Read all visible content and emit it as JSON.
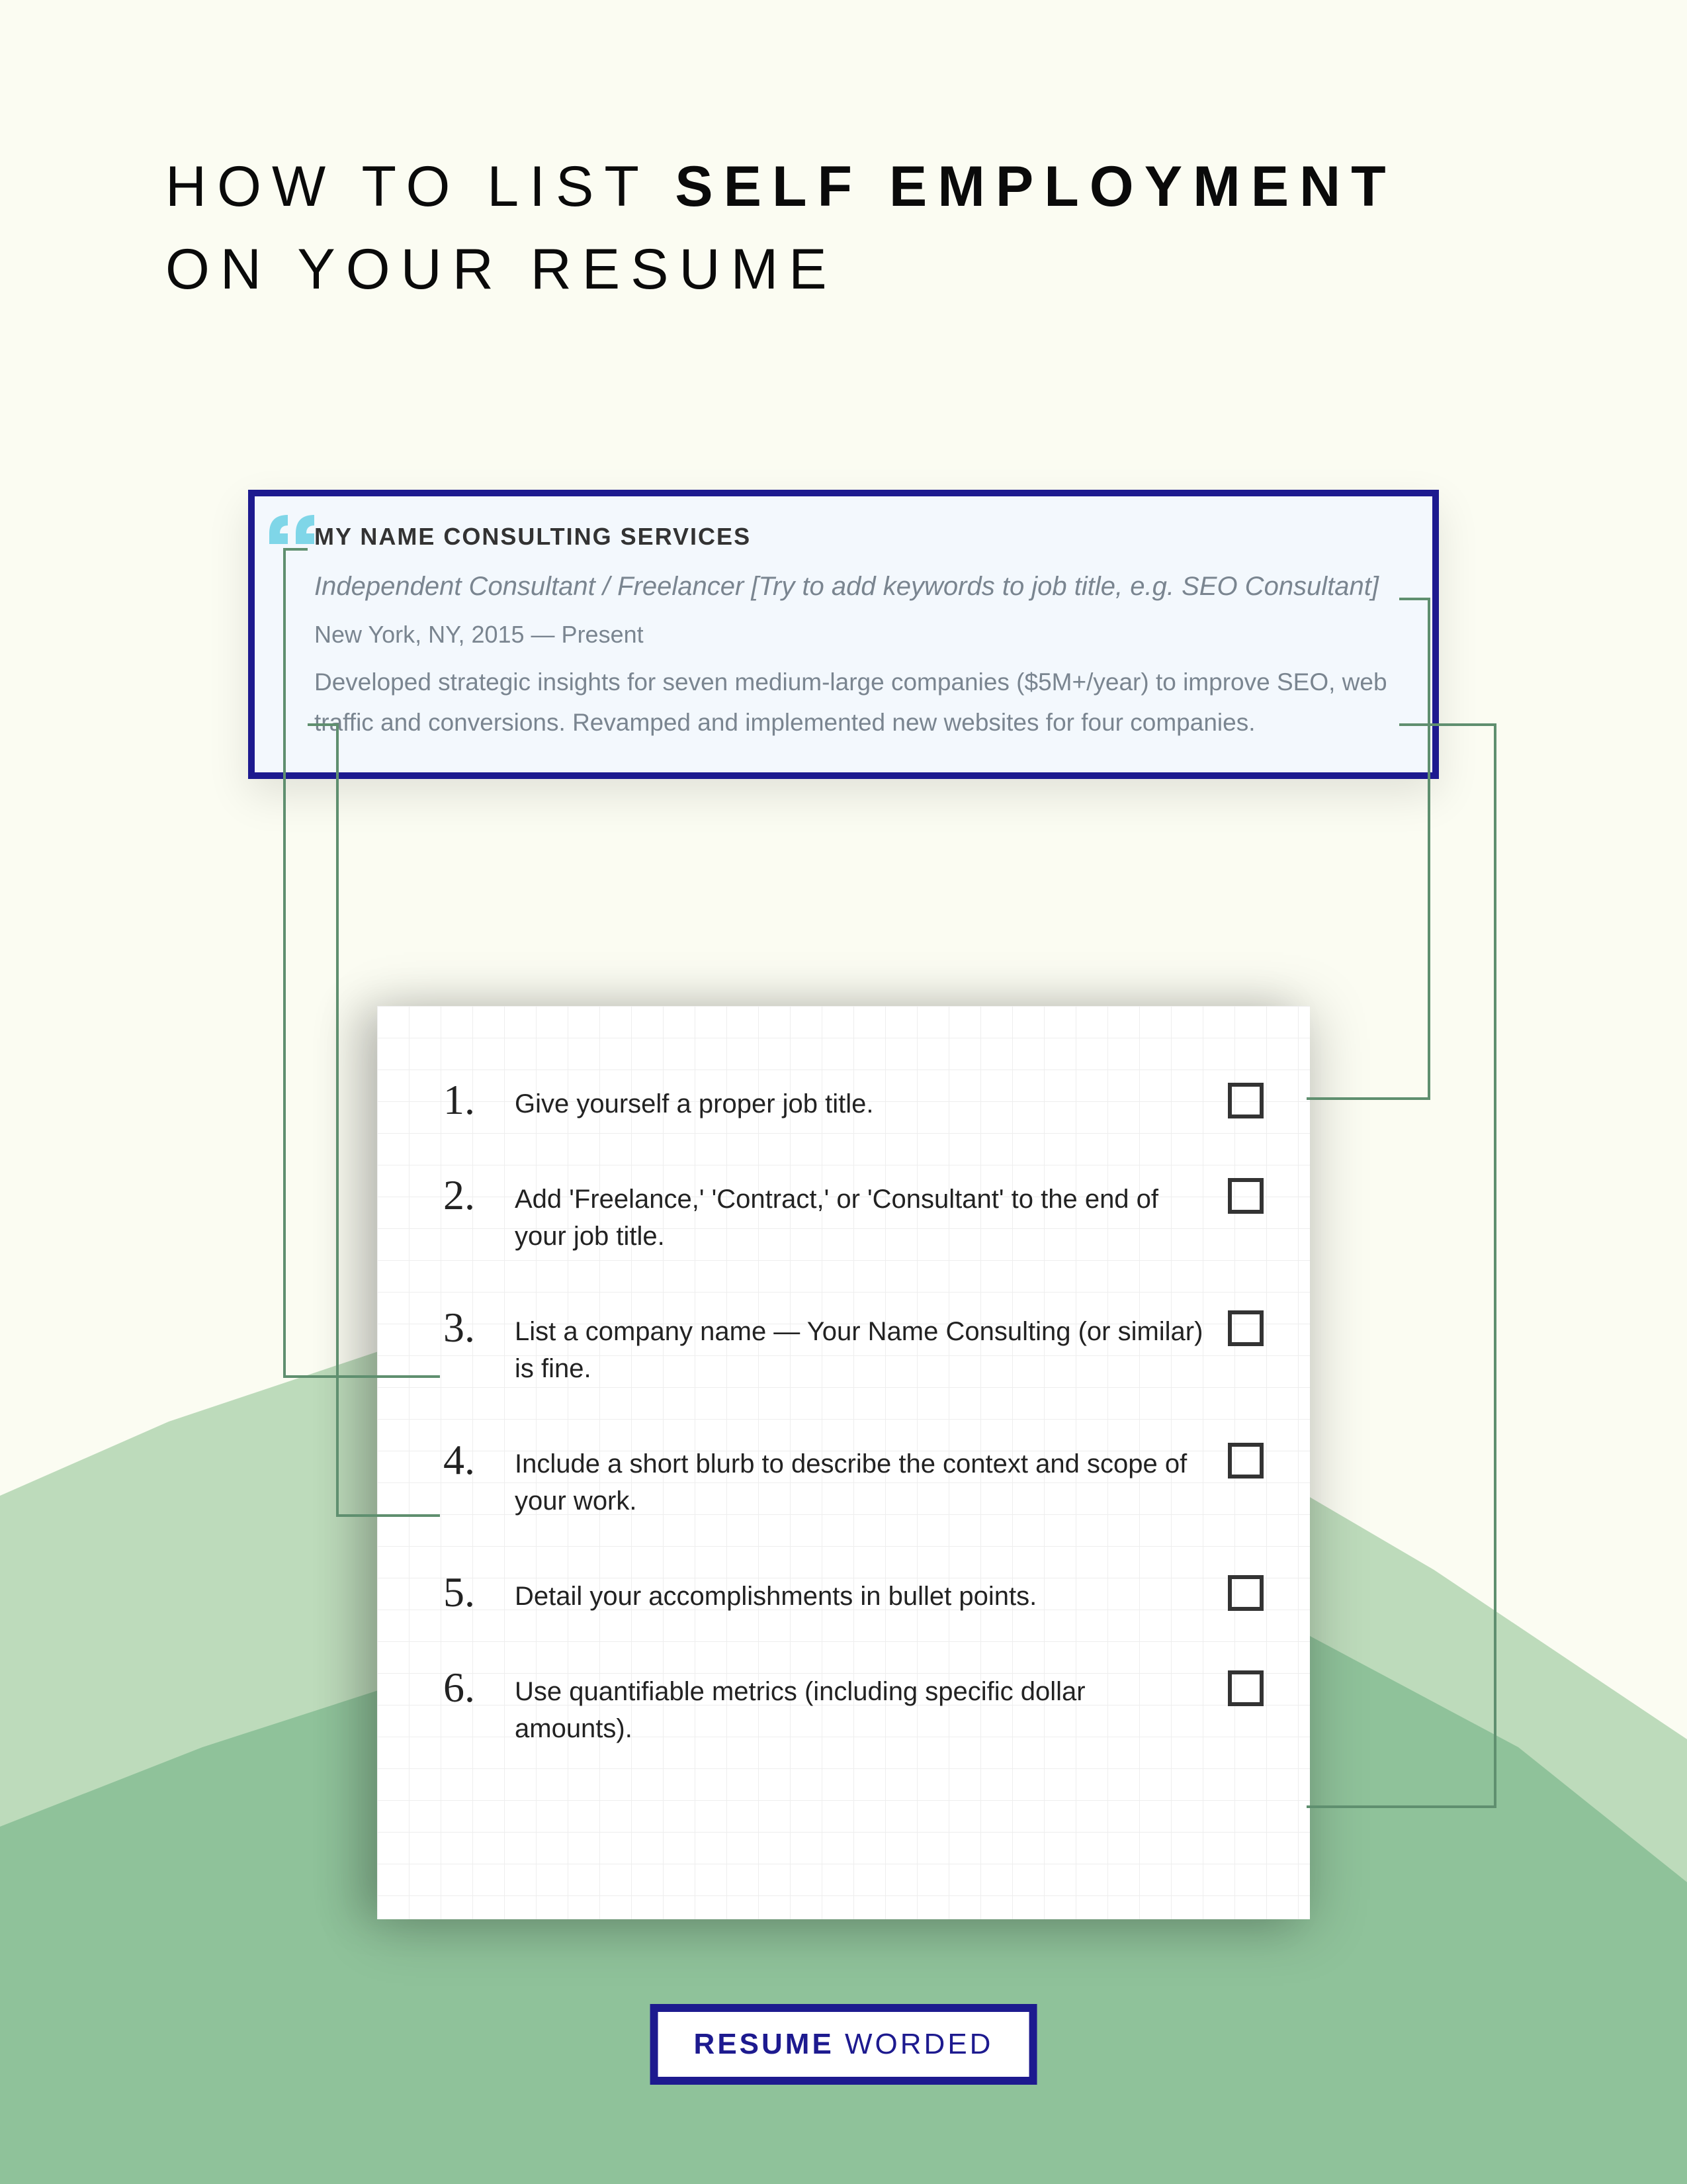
{
  "heading": {
    "pre": "HOW TO LIST ",
    "bold": "SELF EMPLOYMENT",
    "post": "ON YOUR RESUME"
  },
  "example": {
    "company": "MY NAME CONSULTING SERVICES",
    "title": "Independent Consultant / Freelancer [Try to add keywords to job title, e.g. SEO Consultant]",
    "location": "New York, NY, 2015 — Present",
    "body": "Developed strategic insights for seven medium-large companies ($5M+/year) to improve SEO, web traffic and conversions. Revamped and implemented new websites for four companies."
  },
  "checklist": [
    {
      "num": "1.",
      "text": "Give yourself a proper job title."
    },
    {
      "num": "2.",
      "text": "Add 'Freelance,' 'Contract,' or 'Consultant' to the end of your job title."
    },
    {
      "num": "3.",
      "text": "List a company name — Your Name Consulting (or similar) is fine."
    },
    {
      "num": "4.",
      "text": "Include a short blurb to describe the context and scope of your work."
    },
    {
      "num": "5.",
      "text": "Detail your accomplishments in bullet points."
    },
    {
      "num": "6.",
      "text": "Use quantifiable metrics (including specific dollar amounts)."
    }
  ],
  "footer": {
    "brand_bold": "RESUME",
    "brand_light": " WORDED"
  },
  "colors": {
    "accent": "#1d1a8f",
    "wave_light": "#bddbbb",
    "wave_dark": "#8fc29a",
    "bg": "#fbfcf2"
  }
}
